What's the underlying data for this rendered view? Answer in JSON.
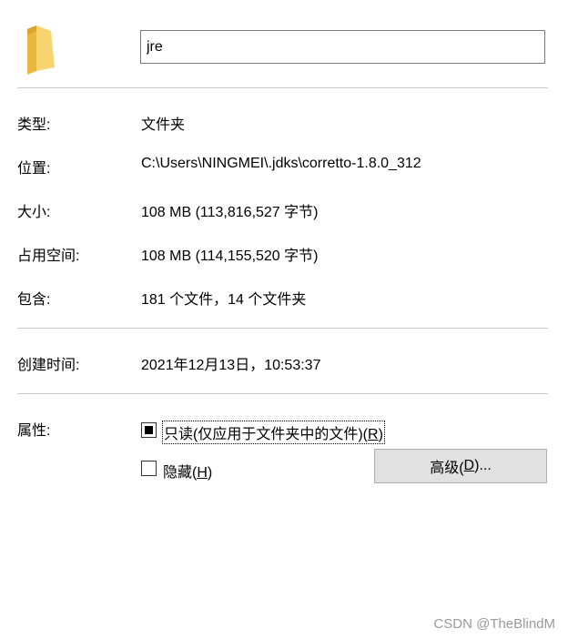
{
  "folder": {
    "icon": "folder-icon",
    "name": "jre"
  },
  "properties": {
    "type_label": "类型:",
    "type_value": "文件夹",
    "location_label": "位置:",
    "location_value": "C:\\Users\\NINGMEI\\.jdks\\corretto-1.8.0_312",
    "size_label": "大小:",
    "size_value": "108 MB (113,816,527 字节)",
    "disk_size_label": "占用空间:",
    "disk_size_value": "108 MB (114,155,520 字节)",
    "contains_label": "包含:",
    "contains_value": "181 个文件，14 个文件夹",
    "created_label": "创建时间:",
    "created_value": "2021年12月13日，10:53:37"
  },
  "attributes": {
    "label": "属性:",
    "readonly_label": "只读(仅应用于文件夹中的文件)(",
    "readonly_key": "R",
    "readonly_close": ")",
    "readonly_state": "indeterminate",
    "hidden_label": "隐藏(",
    "hidden_key": "H",
    "hidden_close": ")",
    "hidden_checked": false,
    "advanced_label": "高级(",
    "advanced_key": "D",
    "advanced_close": ")..."
  },
  "watermark": "CSDN @TheBlindM"
}
